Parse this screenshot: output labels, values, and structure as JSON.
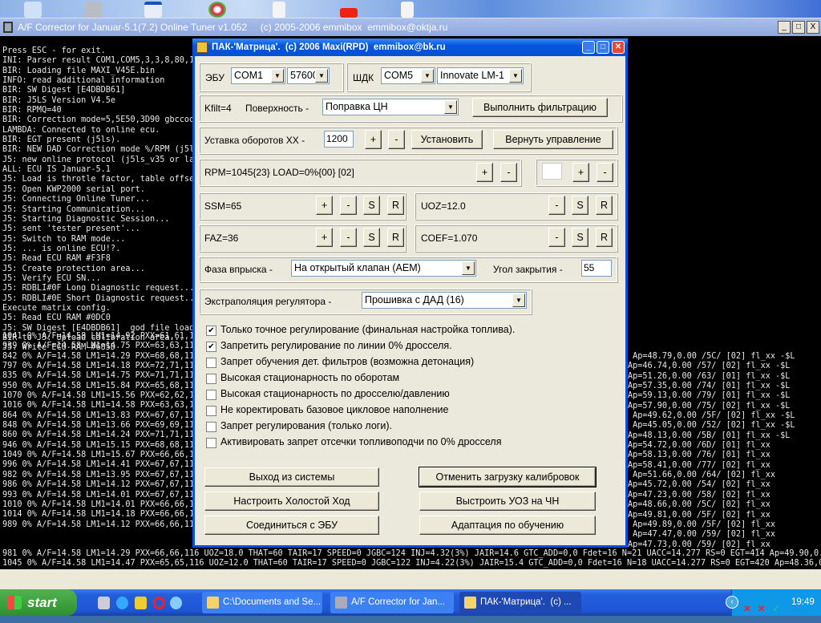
{
  "console_window": {
    "title": "A/F Corrector for Januar-5.1(7.2) Online Tuner v1.052     (c) 2005-2006 emmibox  emmibox@oktja.ru",
    "header_lines": [
      "Press ESC - for exit.",
      "",
      "INI: Parser result COM1,COM5,3,3,8,80,10,3,4,6,",
      "BIR: Loading file MAXI_V45E.bin",
      "INFO: read additional information",
      "BIR: SW Digest [E4DBDB61]",
      "BIR: J5LS Version V4.5e",
      "BIR: RPMQ=40",
      "BIR: Correction mode=5,5E50,3D90 gbccoor+gbcbs",
      "LAMBDA: Connected to online ecu.",
      "BIR: EGT present (j5ls).",
      "BIR: NEW DAD Correction mode %/RPM (j5ls_v45 or",
      "J5: new online protocol (j5ls_v35 or later).",
      "ALL: ECU IS Januar-5.1",
      "J5: Load is throtle factor, table offset=9218",
      "J5: Open KWP2000 serial port.",
      "J5: Connecting Online Tuner...",
      "J5: Starting Communication...",
      "J5: Starting Diagnostic Session...",
      "J5: sent 'tester present'...",
      "J5: Switch to RAM mode...",
      "J5: ... is online ECU!?.",
      "J5: Read ECU RAM #F3F8",
      "J5: Create protection area...",
      "J5: Verify ECU SN...",
      "J5: RDBLI#0F Long Diagnostic request...",
      "J5: RDBLI#0E Short Diagnostic request...",
      "Execute matrix config.",
      "J5: Read ECU RAM #0DC0",
      "J5: SW Digest [E4DBDB61]  god file loaded...",
      "BIR to J5: Upload calibration area...",
      "J5: Write ECU RAM #685D"
    ],
    "data_lines_left": [
      "1041 0% A/F=14.58 LM1=14.92 PXX=61,61,116 UOZ=1",
      "939 0% A/F=14.58 LM1=14.75 PXX=63,63,116 UOZ=21",
      "842 0% A/F=14.58 LM1=14.29 PXX=68,68,116 UOZ=20",
      "797 0% A/F=14.58 LM1=14.18 PXX=72,71,116 UOZ=18",
      "835 0% A/F=14.58 LM1=14.75 PXX=71,71,116 UOZ=14",
      "950 0% A/F=14.58 LM1=15.84 PXX=65,68,116 UOZ=20",
      "1070 0% A/F=14.58 LM1=15.56 PXX=62,62,116 UOZ=1",
      "1016 0% A/F=14.58 LM1=14.58 PXX=63,63,116 UOZ=1",
      "864 0% A/F=14.58 LM1=13.83 PXX=67,67,116 UOZ=21",
      "848 0% A/F=14.58 LM1=13.66 PXX=69,69,116 UOZ=18",
      "860 0% A/F=14.58 LM1=14.24 PXX=71,71,116 UOZ=19",
      "946 0% A/F=14.58 LM1=15.15 PXX=68,68,116 UOZ=16",
      "1049 0% A/F=14.58 LM1=15.67 PXX=66,66,116 UOZ=1",
      "996 0% A/F=14.58 LM1=14.41 PXX=67,67,116 UOZ=16",
      "982 0% A/F=14.58 LM1=13.95 PXX=67,67,116 UOZ=18",
      "986 0% A/F=14.58 LM1=14.12 PXX=67,67,116 UOZ=17",
      "993 0% A/F=14.58 LM1=14.01 PXX=67,67,116 UOZ=17",
      "1010 0% A/F=14.58 LM1=14.01 PXX=66,66,116 UOZ=1",
      "1014 0% A/F=14.58 LM1=14.18 PXX=66,66,116 UOZ=1",
      "989 0% A/F=14.58 LM1=14.12 PXX=66,66,116 UOZ=17"
    ],
    "data_lines_right": [
      " Ap=48.79,0.00 /5C/ [02] fl_xx -$L",
      "Ap=46.74,0.00 /57/ [02] fl_xx -$L",
      "Ap=51.26,0.00 /63/ [01] fl_xx -$L",
      "Ap=57.35,0.00 /74/ [01] fl_xx -$L",
      "Ap=59.13,0.00 /79/ [01] fl_xx -$L",
      "Ap=57.90,0.00 /75/ [02] fl_xx -$L",
      " Ap=49.62,0.00 /5F/ [02] fl_xx -$L",
      " Ap=45.05,0.00 /52/ [02] fl_xx -$L",
      "Ap=48.13,0.00 /5B/ [01] fl_xx -$L",
      "Ap=54.72,0.00 /6D/ [01] fl_xx",
      "Ap=58.13,0.00 /76/ [01] fl_xx",
      "Ap=58.41,0.00 /77/ [02] fl_xx",
      " Ap=51.66,0.00 /64/ [02] fl_xx",
      "Ap=45.72,0.00 /54/ [02] fl_xx",
      "Ap=47.23,0.00 /58/ [02] fl_xx",
      "Ap=48.66,0.00 /5C/ [02] fl_xx",
      "Ap=49.81,0.00 /5F/ [02] fl_xx",
      " Ap=49.89,0.00 /5F/ [02] fl_xx",
      " Ap=47.47,0.00 /59/ [02] fl_xx",
      "Ap=47.73,0.00 /59/ [02] fl_xx"
    ],
    "data_lines_full": [
      "981 0% A/F=14.58 LM1=14.29 PXX=66,66,116 UOZ=18.0 THAT=60 TAIR=17 SPEED=0 JGBC=124 INJ=4.32(3%) JAIR=14.6 GTC_ADD=0,0 Fdet=16 N=21 UACC=14.277 RS=0 EGT=414 Ap=49.90,0.00 /5F/ [02] fl_xx",
      "1045 0% A/F=14.58 LM1=14.47 PXX=65,65,116 UOZ=12.0 THAT=60 TAIR=17 SPEED=0 JGBC=122 INJ=4.22(3%) JAIR=15.4 GTC_ADD=0,0 Fdet=16 N=18 UACC=14.277 RS=0 EGT=420 Ap=48.36,0.00 /5B/ [02] fl_xx"
    ]
  },
  "dialog": {
    "title": "ПАК-'Матрица'.  (c) 2006 Maxi(RPD)  emmibox@bk.ru",
    "ecu_label": "ЭБУ",
    "ecu_port": "COM1",
    "ecu_baud": "57600",
    "wb_label": "ШДК",
    "wb_port": "COM5",
    "wb_device": "Innovate LM-1",
    "kfilt": "Kfilt=4",
    "surface_label": "Поверхность -",
    "surface_value": "Поправка ЦН",
    "filter_button": "Выполнить фильтрацию",
    "idle_label": "Уставка оборотов ХХ -",
    "idle_value": "1200",
    "plus": "+",
    "minus": "-",
    "set_button": "Установить",
    "return_button": "Вернуть управление",
    "rpm_status": "RPM=1045{23} LOAD=0%{00} [02]",
    "aux_value": "",
    "ssm": "SSM=65",
    "uoz": "UOZ=12.0",
    "faz": "FAZ=36",
    "coef": "COEF=1.070",
    "s": "S",
    "r": "R",
    "phase_label": "Фаза впрыска -",
    "phase_value": "На открытый клапан (АЕМ)",
    "angle_label": "Угол закрытия -",
    "angle_value": "55",
    "extrap_label": "Экстраполяция регулятора -",
    "extrap_value": "Прошивка с ДАД (16)",
    "checkboxes": [
      {
        "label": "Только точное регулирование (финальная настройка топлива).",
        "checked": true
      },
      {
        "label": "Запретить регулирование по линии 0% дросселя.",
        "checked": true
      },
      {
        "label": "Запрет обучения дет. фильтров (возможна детонация)",
        "checked": false
      },
      {
        "label": "Высокая стационарность по оборотам",
        "checked": false
      },
      {
        "label": "Высокая стационарность по дросселю/давлению",
        "checked": false
      },
      {
        "label": "Не коректировать базовое цикловое наполнение",
        "checked": false
      },
      {
        "label": "Запрет регулирования (только логи).",
        "checked": false
      },
      {
        "label": "Активировать запрет отсечки топливоподчи по 0% дросселя",
        "checked": false
      }
    ],
    "buttons": {
      "exit": "Выход из системы",
      "cancel_load": "Отменить загрузку калибровок",
      "idle_setup": "Настроить Холостой Ход",
      "uoz_align": "Выстроить УОЗ на ЧН",
      "connect": "Соединиться с ЭБУ",
      "adapt": "Адаптация по обучению"
    }
  },
  "taskbar": {
    "start": "start",
    "tasks": [
      "C:\\Documents and Se...",
      "A/F Corrector for Jan...",
      "ПАК-'Матрица'.  (c) ..."
    ],
    "clock": "19:49"
  },
  "colors": {
    "xp_blue": "#0a4fd8",
    "start_green": "#3a9a3a"
  }
}
